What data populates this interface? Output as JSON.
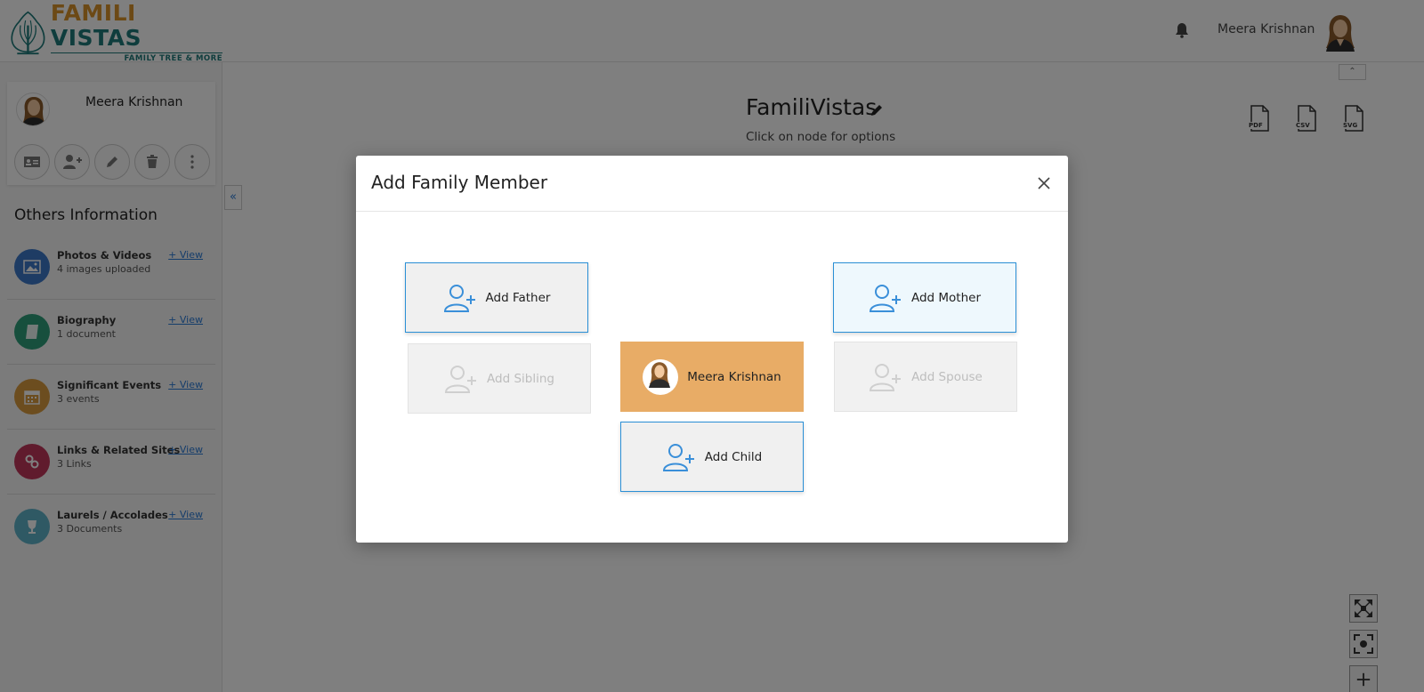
{
  "header": {
    "logo_word1": "FAMILI",
    "logo_word2": "VISTAS",
    "logo_tagline": "FAMILY TREE & MORE",
    "user_name": "Meera Krishnan"
  },
  "profile": {
    "name": "Meera Krishnan"
  },
  "others": {
    "title": "Others Information",
    "items": [
      {
        "title": "Photos & Videos",
        "sub": "4 images uploaded",
        "link": "+ View",
        "color": "#3d78c9",
        "icon": "image-icon"
      },
      {
        "title": "Biography",
        "sub": "1 document",
        "link": "+ View",
        "color": "#2e9e7a",
        "icon": "book-icon"
      },
      {
        "title": "Significant Events",
        "sub": "3 events",
        "link": "+ View",
        "color": "#d99a3f",
        "icon": "calendar-icon"
      },
      {
        "title": "Links & Related Sites",
        "sub": "3 Links",
        "link": "+ View",
        "color": "#c0365a",
        "icon": "link-icon"
      },
      {
        "title": "Laurels / Accolades",
        "sub": "3 Documents",
        "link": "+ View",
        "color": "#5eb2c9",
        "icon": "trophy-icon"
      }
    ]
  },
  "main": {
    "title": "FamiliVistas",
    "subtitle": "Click on node for options",
    "exports": [
      "PDF",
      "CSV",
      "SVG"
    ]
  },
  "modal": {
    "title": "Add Family Member",
    "add_father": "Add Father",
    "add_mother": "Add Mother",
    "add_sibling": "Add Sibling",
    "add_spouse": "Add Spouse",
    "self_name": "Meera Krishnan",
    "add_child": "Add Child"
  },
  "colors": {
    "accent_blue": "#2a8fd6",
    "self_tile": "#e8ac66",
    "brand_orange": "#d9932b",
    "brand_teal": "#1e7a7a"
  }
}
